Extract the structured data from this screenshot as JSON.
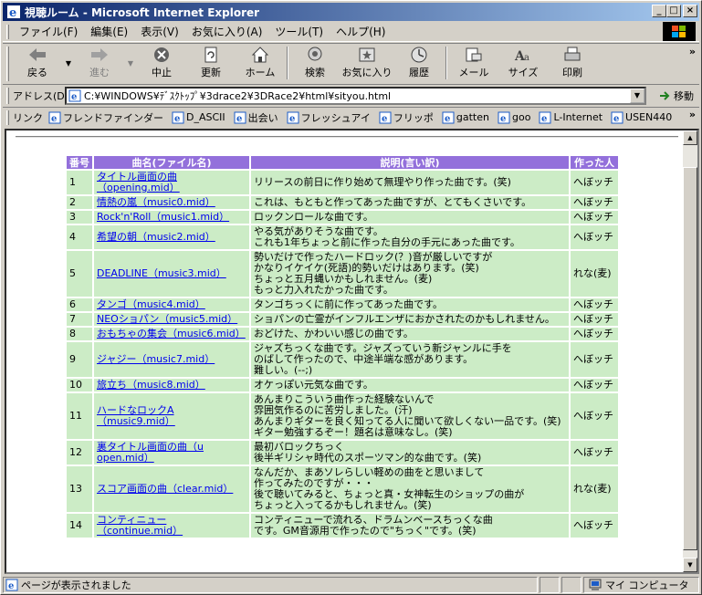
{
  "window": {
    "title": "視聴ルーム - Microsoft Internet Explorer",
    "minimize": "_",
    "maximize": "□",
    "close": "×"
  },
  "menu": [
    "ファイル(F)",
    "編集(E)",
    "表示(V)",
    "お気に入り(A)",
    "ツール(T)",
    "ヘルプ(H)"
  ],
  "toolbar": {
    "back": "戻る",
    "forward": "進む",
    "stop": "中止",
    "refresh": "更新",
    "home": "ホーム",
    "search": "検索",
    "favorites": "お気に入り",
    "history": "履歴",
    "mail": "メール",
    "size": "サイズ",
    "print": "印刷",
    "more": "»"
  },
  "address": {
    "label": "アドレス(D)",
    "value": "C:¥WINDOWS¥ﾃﾞｽｸﾄｯﾌﾟ¥3drace2¥3DRace2¥html¥sityou.html",
    "go": "移動"
  },
  "links": {
    "label": "リンク",
    "items": [
      "フレンドファインダー",
      "D_ASCII",
      "出会い",
      "フレッシュアイ",
      "フリッポ",
      "gatten",
      "goo",
      "L-Internet",
      "USEN440"
    ],
    "more": "»"
  },
  "table": {
    "headers": [
      "番号",
      "曲名(ファイル名)",
      "説明(言い訳)",
      "作った人"
    ],
    "rows": [
      {
        "num": "1",
        "name": "タイトル画面の曲（opening.mid）",
        "desc": [
          "リリースの前日に作り始めて無理やり作った曲です。(笑)"
        ],
        "by": "へぼッチ"
      },
      {
        "num": "2",
        "name": "情熱の嵐（music0.mid）",
        "desc": [
          "これは、もともと作ってあった曲ですが、とてもくさいです。"
        ],
        "by": "へぼッチ"
      },
      {
        "num": "3",
        "name": "Rock'n'Roll（music1.mid）",
        "desc": [
          "ロックンロールな曲です。"
        ],
        "by": "へぼッチ"
      },
      {
        "num": "4",
        "name": "希望の朝（music2.mid）",
        "desc": [
          "やる気がありそうな曲です。",
          "これも1年ちょっと前に作った自分の手元にあった曲です。"
        ],
        "by": "へぼッチ"
      },
      {
        "num": "5",
        "name": "DEADLINE（music3.mid）",
        "desc": [
          "勢いだけで作ったハードロック(？)音が厳しいですが",
          "かなりイケイケ(死語)的勢いだけはあります。(笑)",
          "ちょっと五月蝿いかもしれません。(麦)",
          "もっと力入れたかった曲です。"
        ],
        "by": "れな(麦)"
      },
      {
        "num": "6",
        "name": "タンゴ（music4.mid）",
        "desc": [
          "タンゴちっくに前に作ってあった曲です。"
        ],
        "by": "へぼッチ"
      },
      {
        "num": "7",
        "name": "NEOショパン（music5.mid）",
        "desc": [
          "ショパンの亡霊がインフルエンザにおかされたのかもしれません。"
        ],
        "by": "へぼッチ"
      },
      {
        "num": "8",
        "name": "おもちゃの集会（music6.mid）",
        "desc": [
          "おどけた、かわいい感じの曲です。"
        ],
        "by": "へぼッチ"
      },
      {
        "num": "9",
        "name": "ジャジー（music7.mid）",
        "desc": [
          "ジャズちっくな曲です。ジャズっていう新ジャンルに手を",
          "のばして作ったので、中途半端な感があります。",
          "難しい。(--;)"
        ],
        "by": "へぼッチ"
      },
      {
        "num": "10",
        "name": "旅立ち（music8.mid）",
        "desc": [
          "オケっぽい元気な曲です。"
        ],
        "by": "へぼッチ"
      },
      {
        "num": "11",
        "name": "ハードなロックA（music9.mid）",
        "desc": [
          "あんまりこういう曲作った経験ないんで",
          "雰囲気作るのに苦労しました。(汗)",
          "あんまりギターを良く知ってる人に聞いて欲しくない一品です。(笑)",
          "ギター勉強するぞー！題名は意味なし。(笑)"
        ],
        "by": "へぼッチ"
      },
      {
        "num": "12",
        "name": "裏タイトル画面の曲（u open.mid）",
        "desc": [
          "最初バロックちっく",
          "後半ギリシャ時代のスポーツマン的な曲です。(笑)"
        ],
        "by": "へぼッチ"
      },
      {
        "num": "13",
        "name": "スコア画面の曲（clear.mid）",
        "desc": [
          "なんだか、まあソレらしい軽めの曲をと思いまして",
          "作ってみたのですが・・・",
          "後で聴いてみると、ちょっと真・女神転生のショップの曲が",
          "ちょっと入ってるかもしれません。(笑)"
        ],
        "by": "れな(麦)"
      },
      {
        "num": "14",
        "name": "コンティニュー（continue.mid）",
        "desc": [
          "コンティニューで流れる、ドラムンベースちっくな曲",
          "です。GM音源用で作ったので\"ちっく\"です。(笑)"
        ],
        "by": "へぼッチ"
      }
    ]
  },
  "status": {
    "text": "ページが表示されました",
    "zone": "マイ コンピュータ"
  }
}
